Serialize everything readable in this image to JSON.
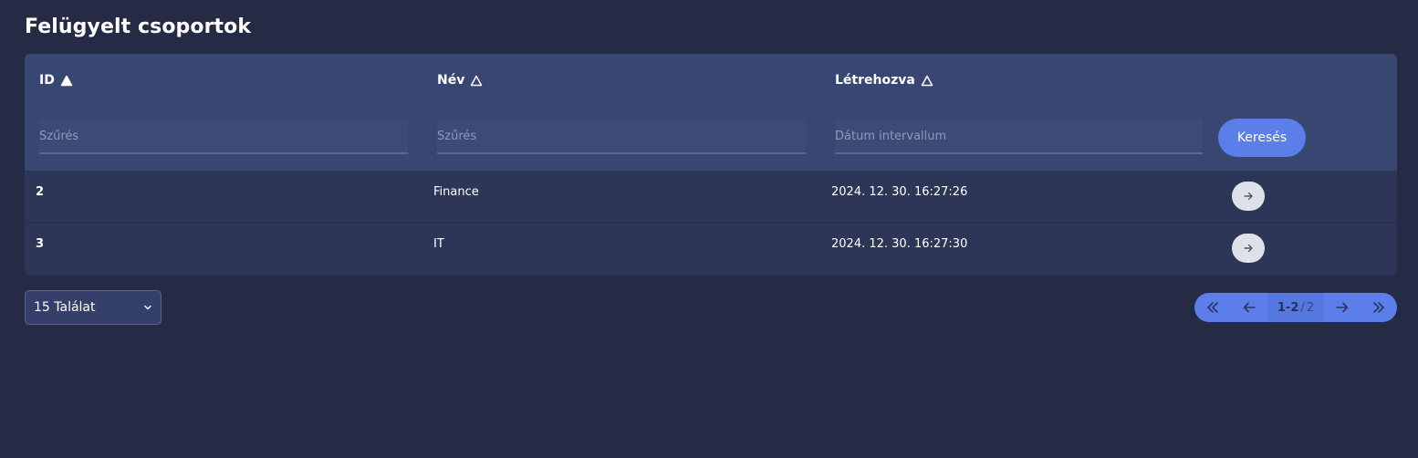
{
  "page": {
    "title": "Felügyelt csoportok"
  },
  "table": {
    "columns": [
      {
        "label": "ID",
        "sort": "asc-filled"
      },
      {
        "label": "Név",
        "sort": "outline"
      },
      {
        "label": "Létrehozva",
        "sort": "outline"
      }
    ],
    "filters": {
      "id_placeholder": "Szűrés",
      "name_placeholder": "Szűrés",
      "created_placeholder": "Dátum intervallum",
      "id_value": "",
      "name_value": "",
      "created_value": ""
    },
    "search_label": "Keresés",
    "rows": [
      {
        "id": "2",
        "name": "Finance",
        "created": "2024. 12. 30. 16:27:26",
        "action_icon": "arrow-right-icon"
      },
      {
        "id": "3",
        "name": "IT",
        "created": "2024. 12. 30. 16:27:30",
        "action_icon": "arrow-right-icon"
      }
    ]
  },
  "pagination": {
    "page_size_label": "15 Találat",
    "range": "1-2",
    "separator": "/",
    "total": "2",
    "icons": [
      "double-chevron-left-icon",
      "arrow-left-icon",
      "arrow-right-icon",
      "double-chevron-right-icon"
    ]
  },
  "colors": {
    "background": "#252b45",
    "card": "#2e3657",
    "header": "#384672",
    "accent": "#5b7ee8"
  }
}
